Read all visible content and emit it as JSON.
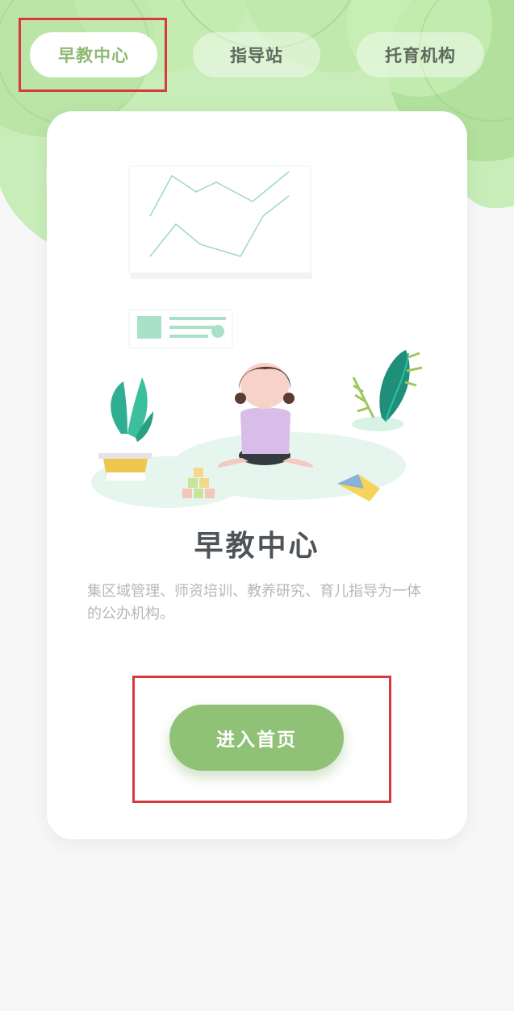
{
  "tabs": [
    {
      "label": "早教中心",
      "active": true
    },
    {
      "label": "指导站",
      "active": false
    },
    {
      "label": "托育机构",
      "active": false
    }
  ],
  "card": {
    "title": "早教中心",
    "description": "集区域管理、师资培训、教养研究、育儿指导为一体的公办机构。",
    "button_label": "进入首页"
  },
  "colors": {
    "accent_green": "#8fc277",
    "active_tab_text": "#8fb873",
    "background_green": "#b9e3a8",
    "highlight_red": "#d9383f"
  }
}
